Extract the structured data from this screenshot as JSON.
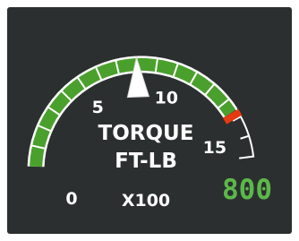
{
  "gauge": {
    "title_line1": "TORQUE",
    "title_line2": "FT-LB",
    "multiplier": "X100",
    "scale_labels": [
      {
        "value": 0,
        "text": "0"
      },
      {
        "value": 5,
        "text": "5"
      },
      {
        "value": 10,
        "text": "10"
      },
      {
        "value": 15,
        "text": "15"
      }
    ],
    "scale_min": 0,
    "scale_max": 16,
    "green_band": [
      0,
      13.5
    ],
    "redline": 13.8,
    "pointer_value": 8,
    "digital_readout": "800",
    "colors": {
      "background": "#2b2f2f",
      "arc_green": "#4aa02c",
      "redline": "#e63a12",
      "ticks": "#ffffff",
      "pointer": "#ffffff",
      "readout": "#5cb84a"
    }
  }
}
